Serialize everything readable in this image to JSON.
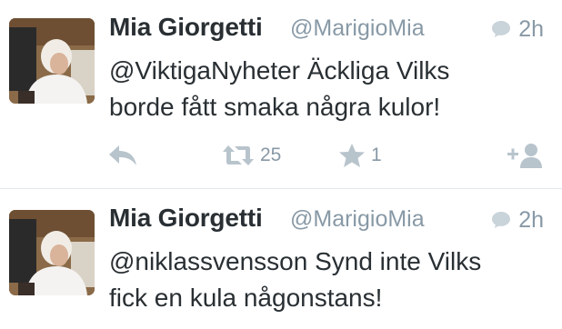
{
  "colors": {
    "text": "#292f33",
    "muted": "#8899a6",
    "icon": "#b8c4cc",
    "divider": "#e1e8ed"
  },
  "tweets": [
    {
      "display_name": "Mia Giorgetti",
      "handle": "@MarigioMia",
      "time": "2h",
      "text_lines": [
        "@ViktigaNyheter Äckliga Vilks",
        "borde fått smaka några kulor!"
      ],
      "retweet_count": "25",
      "favorite_count": "1",
      "icons": [
        "reply-icon",
        "retweet-icon",
        "star-icon",
        "follow-icon",
        "speech-bubble-icon"
      ]
    },
    {
      "display_name": "Mia Giorgetti",
      "handle": "@MarigioMia",
      "time": "2h",
      "text_lines": [
        "@niklassvensson Synd inte Vilks",
        "fick en kula någonstans!"
      ],
      "icons": [
        "speech-bubble-icon"
      ]
    }
  ]
}
